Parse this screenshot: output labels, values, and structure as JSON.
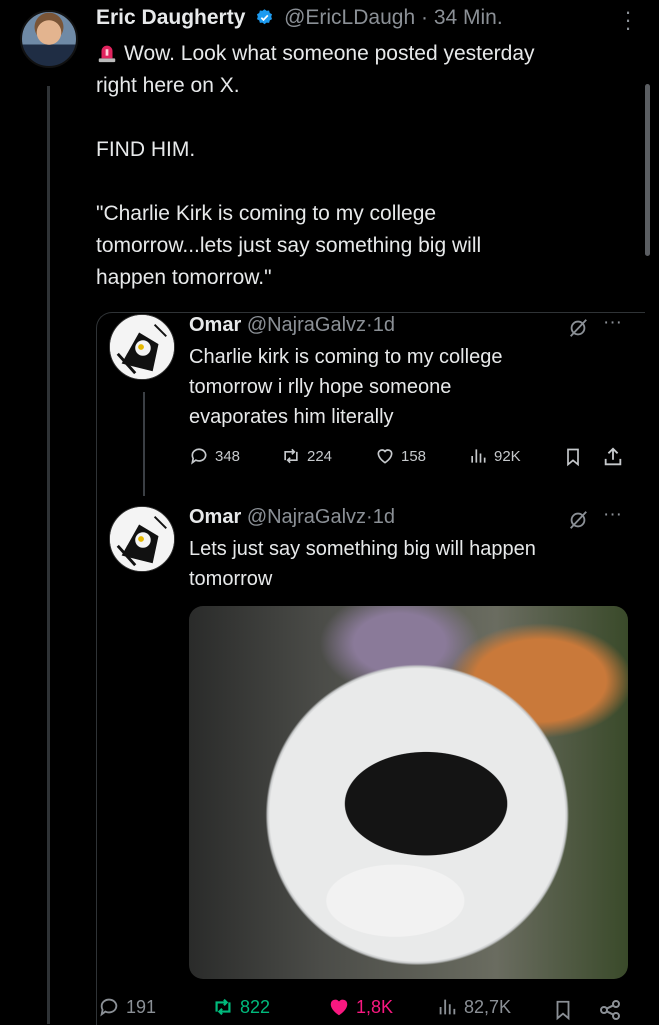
{
  "tweet": {
    "author_name": "Eric Daugherty",
    "handle": "@EricLDaugh",
    "separator": "·",
    "time": "34 Min.",
    "body": "Wow. Look what someone posted yesterday\nright here on X.\n\nFIND HIM.\n\n\"Charlie Kirk is coming to my college\ntomorrow...lets just say something big will\nhappen tomorrow.\""
  },
  "quoted": [
    {
      "author_name": "Omar",
      "handle": "@NajraGalvz",
      "separator": "·",
      "time": "1d",
      "body": "Charlie kirk is coming to my college\ntomorrow i rlly hope someone\nevaporates him literally",
      "replies": "348",
      "reposts": "224",
      "likes": "158",
      "views": "92K"
    },
    {
      "author_name": "Omar",
      "handle": "@NajraGalvz",
      "separator": "·",
      "time": "1d",
      "body": "Lets just say something big will happen\ntomorrow"
    }
  ],
  "engagement": {
    "replies": "191",
    "reposts": "822",
    "likes": "1,8K",
    "views": "82,7K"
  },
  "colors": {
    "background": "#000000",
    "text": "#e7e9ea",
    "muted": "#8b9096",
    "verified": "#1d9bf0",
    "repost": "#00ba7c",
    "like": "#f91880"
  },
  "icons": {
    "verified": "verified-badge-icon",
    "siren": "siren-icon",
    "more": "more-icon",
    "grok": "grok-icon",
    "reply": "reply-icon",
    "repost": "repost-icon",
    "like": "heart-icon",
    "views": "views-icon",
    "bookmark": "bookmark-icon",
    "share": "share-icon"
  }
}
